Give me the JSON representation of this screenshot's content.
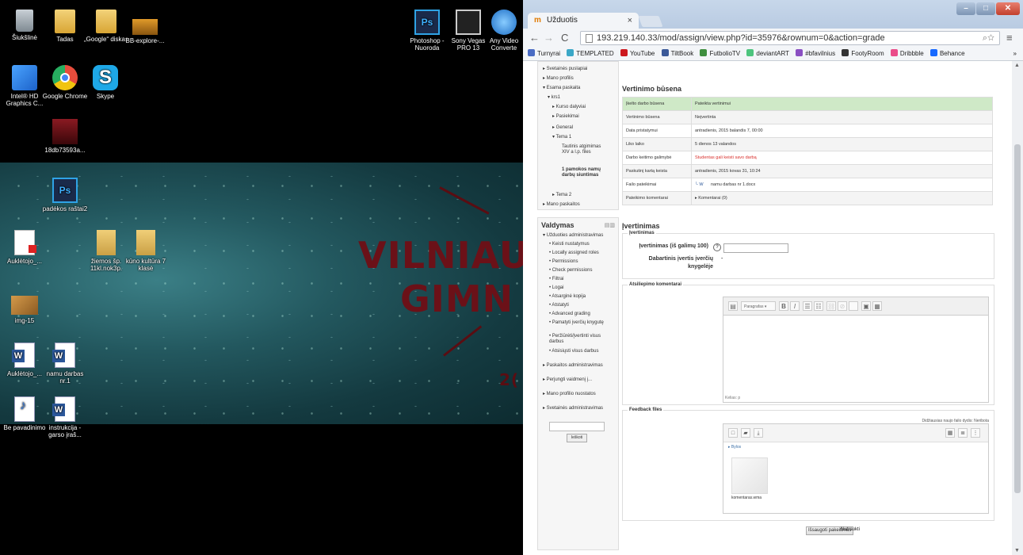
{
  "desktop": {
    "icons": [
      {
        "label": "Šiukšlinė",
        "icon": "recycle-bin-icon"
      },
      {
        "label": "Tadas",
        "icon": "user-folder-icon"
      },
      {
        "label": "„Google“ diskas",
        "icon": "google-drive-icon"
      },
      {
        "label": "BB-explore-...",
        "icon": "shortcut-icon"
      },
      {
        "label": "Intel® HD Graphics C...",
        "icon": "intel-graphics-icon"
      },
      {
        "label": "Google Chrome",
        "icon": "chrome-icon"
      },
      {
        "label": "Skype",
        "icon": "skype-icon"
      },
      {
        "label": "18db73593a...",
        "icon": "image-file-icon"
      },
      {
        "label": "padėkos raštai2",
        "icon": "photoshop-file-icon"
      },
      {
        "label": "Auklėtojo_...",
        "icon": "pdf-icon"
      },
      {
        "label": "žiemos šp. 11kl.nok3p.",
        "icon": "folder-icon"
      },
      {
        "label": "kūno kultūra 7 klasė",
        "icon": "folder-icon"
      },
      {
        "label": "img-15",
        "icon": "image-file-icon"
      },
      {
        "label": "Auklėtojo_...",
        "icon": "word-icon"
      },
      {
        "label": "namu darbas nr.1",
        "icon": "word-icon"
      },
      {
        "label": "Be pavadinimo",
        "icon": "wma-icon"
      },
      {
        "label": "instrukcija - garso įraš...",
        "icon": "word-icon"
      },
      {
        "label": "Photoshop - Nuoroda",
        "icon": "photoshop-icon"
      },
      {
        "label": "Sony Vegas PRO 13",
        "icon": "vegas-icon"
      },
      {
        "label": "Any Video Converte",
        "icon": "video-converter-icon"
      }
    ],
    "wallpaper_text": [
      "VILNIAU",
      "GIMN",
      "2("
    ]
  },
  "browser": {
    "tab_title": "Užduotis",
    "tab_close": "×",
    "url": "193.219.140.33/mod/assign/view.php?id=35976&rownum=0&action=grade",
    "bookmarks": [
      {
        "label": "Turnyrai",
        "color": "#4a6cc4"
      },
      {
        "label": "TEMPLATED",
        "color": "#3aa7c7"
      },
      {
        "label": "YouTube",
        "color": "#cc181e"
      },
      {
        "label": "TiltBook",
        "color": "#3b5998"
      },
      {
        "label": "FutbolioTV",
        "color": "#3e8e3e"
      },
      {
        "label": "deviantART",
        "color": "#4dc47d"
      },
      {
        "label": "#bfavilnius",
        "color": "#8a4fc2"
      },
      {
        "label": "FootyRoom",
        "color": "#333333"
      },
      {
        "label": "Dribbble",
        "color": "#ea4c89"
      },
      {
        "label": "Behance",
        "color": "#1769ff"
      }
    ],
    "bookmarks_more": "»"
  },
  "nav_block": {
    "items": [
      {
        "label": "▸ Svetainės puslapiai",
        "indent": 0
      },
      {
        "label": "▸ Mano profilis",
        "indent": 0
      },
      {
        "label": "▾ Esama paskaita",
        "indent": 0
      },
      {
        "label": "▾ krs1",
        "indent": 1
      },
      {
        "label": "▸ Kurso dalyviai",
        "indent": 2
      },
      {
        "label": "▸ Pasiekimai",
        "indent": 2
      },
      {
        "label": "▸ General",
        "indent": 2
      },
      {
        "label": "▾ Tema 1",
        "indent": 2
      },
      {
        "label": "Tautinis atgimimas XIV a l.p. files",
        "indent": 3
      },
      {
        "label": "1 pamokos namų darbų siuntimas",
        "indent": 3
      },
      {
        "label": "▸ Tema 2",
        "indent": 2
      },
      {
        "label": "▸ Mano paskaitos",
        "indent": 0
      }
    ]
  },
  "admin_block": {
    "title": "Valdymas",
    "items": [
      "▾ Užduoties administravimas",
      "• Keisti nustatymus",
      "• Locally assigned roles",
      "• Permissions",
      "• Check permissions",
      "• Filtrai",
      "• Logai",
      "• Atsarginė kopija",
      "• Atstatyti",
      "• Advanced grading",
      "• Pamatyti įverčių knygutę",
      "• Peržiūrėti/įvertinti visus darbus",
      "• Atsisiųsti visus darbus",
      "▸ Paskaitos administravimas",
      "▸ Perjungti vaidmenį į...",
      "▸ Mano profilio nuostatos",
      "▸ Svetainės administravimas"
    ],
    "search_button": "Ieškoti"
  },
  "grading_status": {
    "heading": "Vertinimo būsena",
    "rows": [
      {
        "key": "Įkelto darbo būsena",
        "value": "Pateikta vertinimui"
      },
      {
        "key": "Vertinimo būsena",
        "value": "Neįvertinta"
      },
      {
        "key": "Data pristatymui",
        "value": "antradienis, 2015 balandis 7, 00:00"
      },
      {
        "key": "Liko laiko",
        "value": "5 dienos 13 valandos"
      },
      {
        "key": "Darbo keitimo galimybė",
        "value": "Studentas gali keisti savo darbą"
      },
      {
        "key": "Paskutinį kartą keista",
        "value": "antradienis, 2015 kovas 31, 10:24"
      },
      {
        "key": "Failo pateikimai",
        "value": "namu darbas nr 1.docx"
      },
      {
        "key": "Pateikimo komentarai",
        "value": "▸ Komentarai (0)"
      }
    ]
  },
  "grade_form": {
    "heading": "Įvertinimas",
    "fieldset_legend": "Įvertinimas",
    "grade_label": "Įvertinimas (iš galimų 100)",
    "current_label_1": "Dabartinis įvertis įverčių",
    "current_label_2": "knygelėje",
    "current_value": "-",
    "feedback_legend": "Atsiliepimo komentarai",
    "editor_format": "Paragrafas",
    "editor_path": "Kelias: p",
    "files_legend": "Feedback files",
    "max_size_note": "Didžiausias naujo failo dydis: Neribota",
    "folder_label": "Bylos",
    "file_name": "komentaras.wma",
    "save_button": "Išsaugoti pakeitimus",
    "cancel_button": "Nutraukti"
  }
}
